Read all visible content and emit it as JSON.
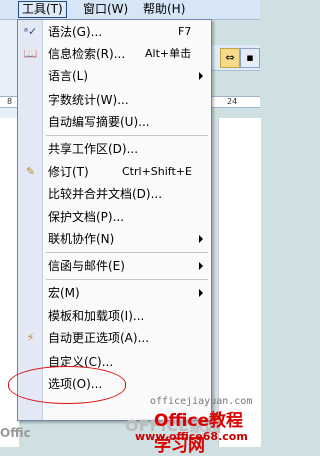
{
  "menubar": {
    "items": [
      {
        "label": "工具(T)"
      },
      {
        "label": "窗口(W)"
      },
      {
        "label": "帮助(H)"
      }
    ]
  },
  "ruler": {
    "left_number": "8",
    "right_number": "24"
  },
  "menu": {
    "items": [
      {
        "label": "语法(G)...",
        "shortcut": "F7",
        "icon": "grammar-icon"
      },
      {
        "label": "信息检索(R)...",
        "shortcut": "Alt+单击",
        "icon": "research-icon"
      },
      {
        "label": "语言(L)",
        "submenu": true
      },
      {
        "label": "字数统计(W)..."
      },
      {
        "label": "自动编写摘要(U)..."
      },
      {
        "label": "共享工作区(D)..."
      },
      {
        "label": "修订(T)",
        "shortcut": "Ctrl+Shift+E",
        "icon": "track-changes-icon"
      },
      {
        "label": "比较并合并文档(D)..."
      },
      {
        "label": "保护文档(P)..."
      },
      {
        "label": "联机协作(N)",
        "submenu": true
      },
      {
        "label": "信函与邮件(E)",
        "submenu": true
      },
      {
        "label": "宏(M)",
        "submenu": true
      },
      {
        "label": "模板和加载项(I)..."
      },
      {
        "label": "自动更正选项(A)...",
        "icon": "autocorrect-icon"
      },
      {
        "label": "自定义(C)..."
      },
      {
        "label": "选项(O)..."
      }
    ]
  },
  "watermark": {
    "small": "officejiayuan.com",
    "big": "Office教程学习网",
    "url": "www.office68.com",
    "ghost": "OFFICE家园",
    "ghost_left": "Offic"
  },
  "colors": {
    "highlight_oval": "#dd1111",
    "watermark_red": "#dd0000"
  }
}
